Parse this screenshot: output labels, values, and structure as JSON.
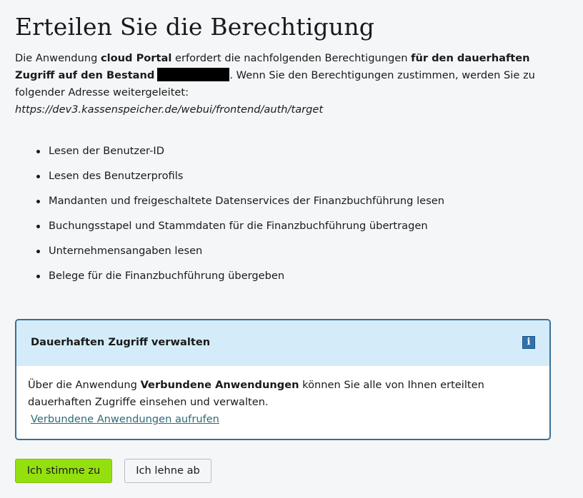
{
  "page": {
    "title": "Erteilen Sie die Berechtigung"
  },
  "intro": {
    "prefix": "Die Anwendung ",
    "app_name": "cloud Portal",
    "middle": " erfordert die nachfolgenden Berechtigungen ",
    "access_type": "für den dauerhaften Zugriff auf den Bestand",
    "suffix": ". Wenn Sie den Berechtigungen zustimmen, werden Sie zu folgender Adresse weitergeleitet:",
    "redirect_url": "https://dev3.kassenspeicher.de/webui/frontend/auth/target"
  },
  "permissions": [
    "Lesen der Benutzer-ID",
    "Lesen des Benutzerprofils",
    "Mandanten und freigeschaltete Datenservices der Finanzbuchführung lesen",
    "Buchungsstapel und Stammdaten für die Finanzbuchführung übertragen",
    "Unternehmensangaben lesen",
    "Belege für die Finanzbuchführung übergeben"
  ],
  "info_box": {
    "title": "Dauerhaften Zugriff verwalten",
    "icon": "info-icon",
    "icon_glyph": "i",
    "body_prefix": "Über die Anwendung ",
    "body_app": "Verbundene Anwendungen",
    "body_suffix": " können Sie alle von Ihnen erteilten dauerhaften Zugriffe einsehen und verwalten.",
    "link_label": "Verbundene Anwendungen aufrufen"
  },
  "actions": {
    "accept_label": "Ich stimme zu",
    "decline_label": "Ich lehne ab"
  },
  "colors": {
    "accept_button": "#94e00f",
    "info_border": "#3a6f96",
    "info_header": "#d4ecfa",
    "link": "#2d6b7a"
  }
}
